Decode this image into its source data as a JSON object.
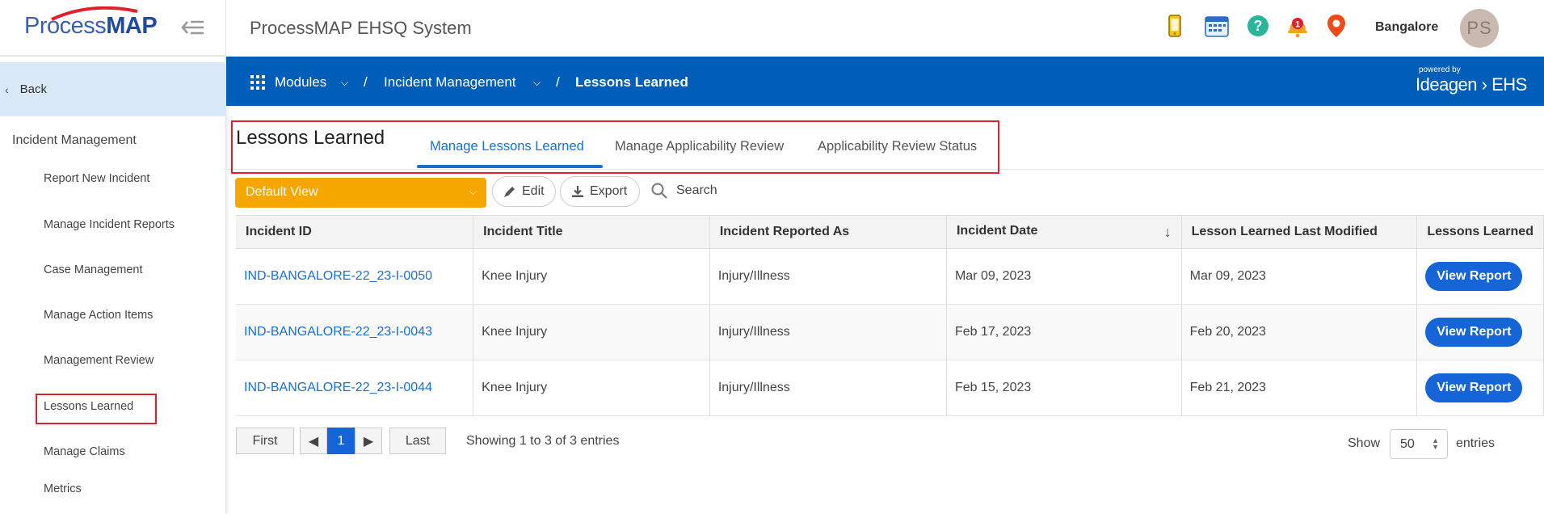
{
  "sidebar": {
    "logo": {
      "part1": "Process",
      "part2": "MAP"
    },
    "back_label": "Back",
    "section_title": "Incident Management",
    "items": [
      {
        "label": "Report New Incident"
      },
      {
        "label": "Manage Incident Reports"
      },
      {
        "label": "Case Management"
      },
      {
        "label": "Manage Action Items"
      },
      {
        "label": "Management Review"
      },
      {
        "label": "Lessons Learned"
      },
      {
        "label": "Manage Claims"
      },
      {
        "label": "Metrics"
      }
    ]
  },
  "header": {
    "title": "ProcessMAP EHSQ System",
    "location": "Bangalore",
    "avatar_initials": "PS",
    "icons": [
      "mobile-icon",
      "calendar-icon",
      "help-icon",
      "notification-bell-icon",
      "location-pin-icon"
    ],
    "notification_count": "1"
  },
  "nav": {
    "modules_label": "Modules",
    "module_label": "Incident Management",
    "current_label": "Lessons Learned",
    "separator": "/",
    "powered_by": "powered by",
    "brand": "Ideagen",
    "brand_suffix": "EHS"
  },
  "page": {
    "heading": "Lessons Learned",
    "tabs": [
      {
        "label": "Manage Lessons Learned",
        "active": true
      },
      {
        "label": "Manage Applicability Review",
        "active": false
      },
      {
        "label": "Applicability Review Status",
        "active": false
      }
    ]
  },
  "toolbar": {
    "view_select": "Default View",
    "edit_label": "Edit",
    "export_label": "Export",
    "search_label": "Search"
  },
  "table": {
    "columns": [
      "Incident ID",
      "Incident Title",
      "Incident Reported As",
      "Incident Date",
      "Lesson Learned Last Modified",
      "Lessons Learned"
    ],
    "rows": [
      {
        "id": "IND-BANGALORE-22_23-I-0050",
        "title": "Knee Injury",
        "reported_as": "Injury/Illness",
        "date": "Mar 09, 2023",
        "modified": "Mar 09, 2023",
        "action": "View Report"
      },
      {
        "id": "IND-BANGALORE-22_23-I-0043",
        "title": "Knee Injury",
        "reported_as": "Injury/Illness",
        "date": "Feb 17, 2023",
        "modified": "Feb 20, 2023",
        "action": "View Report"
      },
      {
        "id": "IND-BANGALORE-22_23-I-0044",
        "title": "Knee Injury",
        "reported_as": "Injury/Illness",
        "date": "Feb 15, 2023",
        "modified": "Feb 21, 2023",
        "action": "View Report"
      }
    ]
  },
  "pagination": {
    "first_label": "First",
    "last_label": "Last",
    "current_page": "1",
    "info": "Showing 1 to 3 of 3 entries",
    "show_label": "Show",
    "page_size": "50",
    "entries_label": "entries"
  },
  "colors": {
    "brand_blue": "#005eb8",
    "accent_orange": "#f5a700",
    "link_blue": "#1a6fd0",
    "highlight_red": "#e0202c"
  }
}
